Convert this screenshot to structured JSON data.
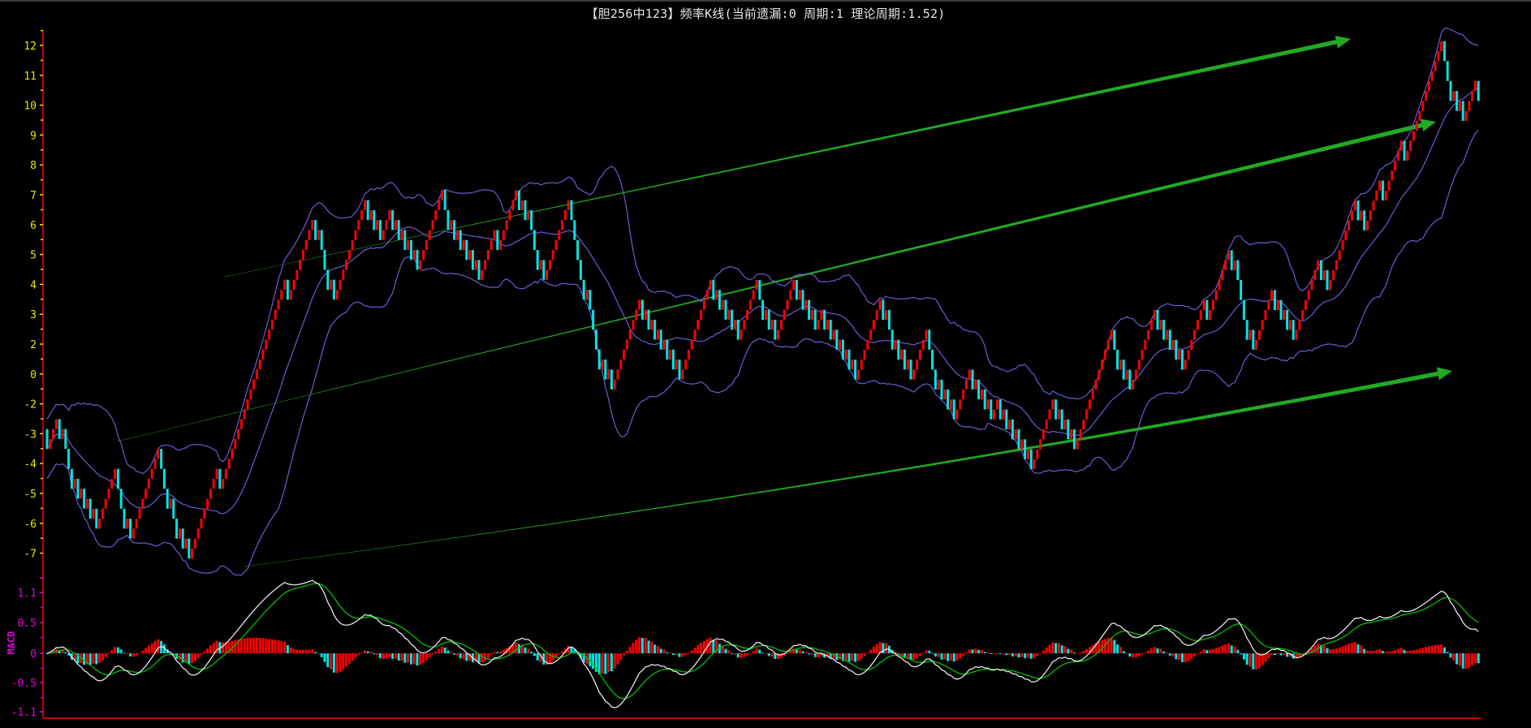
{
  "title": "【胆256中123】频率K线(当前遗漏:0 周期:1 理论周期:1.52)",
  "colors": {
    "up": "#ff0000",
    "down": "#00e5e5",
    "band": "#6a5cd6",
    "axis": "#c00000",
    "price_label": "#e6e600",
    "macd_label": "#e000e0",
    "dif": "#e8e8e8",
    "dea": "#00c000",
    "trend": "#22aa22"
  },
  "chart_data": [
    {
      "type": "candlestick",
      "title": "【胆256中123】频率K线(当前遗漏:0 周期:1 理论周期:1.52)",
      "step_up": 0.3333,
      "step_down": -0.6667,
      "candle_count": 465,
      "bollinger": {
        "period": 20,
        "k": 2
      },
      "yticks": [
        {
          "pos": 12,
          "label": "12"
        },
        {
          "pos": 11,
          "label": "11"
        },
        {
          "pos": 10,
          "label": "10"
        },
        {
          "pos": 9,
          "label": "9"
        },
        {
          "pos": 8,
          "label": "8"
        },
        {
          "pos": 7,
          "label": "7"
        },
        {
          "pos": 6,
          "label": "6"
        },
        {
          "pos": 5,
          "label": "5"
        },
        {
          "pos": 4,
          "label": "4"
        },
        {
          "pos": 3,
          "label": "3"
        },
        {
          "pos": 2,
          "label": "2"
        },
        {
          "pos": 1,
          "label": "0"
        },
        {
          "pos": 0,
          "label": "-2"
        },
        {
          "pos": -1,
          "label": "-3"
        },
        {
          "pos": -2,
          "label": "-4"
        },
        {
          "pos": -3,
          "label": "-5"
        },
        {
          "pos": -4,
          "label": "-6"
        },
        {
          "pos": -5,
          "label": "-7"
        }
      ],
      "close_waypoints": [
        [
          0,
          -1.51
        ],
        [
          5,
          -1.02
        ],
        [
          8,
          -3.0
        ],
        [
          16,
          -4.13
        ],
        [
          22,
          -2.65
        ],
        [
          27,
          -4.29
        ],
        [
          36,
          -1.77
        ],
        [
          41,
          -3.47
        ],
        [
          46,
          -5.17
        ],
        [
          57,
          -2.82
        ],
        [
          70,
          2.08
        ],
        [
          79,
          3.39
        ],
        [
          89,
          5.35
        ],
        [
          93,
          3.72
        ],
        [
          109,
          5.51
        ],
        [
          120,
          4.86
        ],
        [
          128,
          6.72
        ],
        [
          133,
          5.51
        ],
        [
          141,
          4.21
        ],
        [
          147,
          5.35
        ],
        [
          157,
          6.0
        ],
        [
          161,
          4.53
        ],
        [
          169,
          6.56
        ],
        [
          176,
          3.39
        ],
        [
          184,
          0.51
        ],
        [
          195,
          2.9
        ],
        [
          206,
          0.94
        ],
        [
          218,
          3.23
        ],
        [
          225,
          2.25
        ],
        [
          231,
          3.55
        ],
        [
          237,
          2.41
        ],
        [
          250,
          2.74
        ],
        [
          263,
          0.94
        ],
        [
          272,
          2.9
        ],
        [
          280,
          0.94
        ],
        [
          285,
          2.41
        ],
        [
          294,
          -0.2
        ],
        [
          307,
          -0.53
        ],
        [
          320,
          -2.33
        ],
        [
          328,
          -0.2
        ],
        [
          332,
          -0.86
        ],
        [
          334,
          -1.51
        ],
        [
          345,
          2.74
        ],
        [
          351,
          0.78
        ],
        [
          361,
          2.41
        ],
        [
          369,
          1.43
        ],
        [
          377,
          2.74
        ],
        [
          386,
          4.53
        ],
        [
          392,
          2.08
        ],
        [
          399,
          3.23
        ],
        [
          405,
          2.25
        ],
        [
          410,
          3.72
        ],
        [
          416,
          3.72
        ],
        [
          427,
          6.0
        ],
        [
          434,
          6.98
        ],
        [
          440,
          8.62
        ],
        [
          452,
          11.72
        ],
        [
          456,
          10.41
        ],
        [
          460,
          9.76
        ],
        [
          464,
          10.25
        ]
      ]
    },
    {
      "type": "macd",
      "label": "MACD",
      "yticks": [
        {
          "pos": 1.1,
          "label": "1.1"
        },
        {
          "pos": 0.55,
          "label": "0.5"
        },
        {
          "pos": 0,
          "label": "0"
        },
        {
          "pos": -0.55,
          "label": "-0.5"
        },
        {
          "pos": -1.1,
          "label": "-1.1"
        }
      ],
      "fast": 12,
      "slow": 26,
      "signal": 9
    }
  ]
}
